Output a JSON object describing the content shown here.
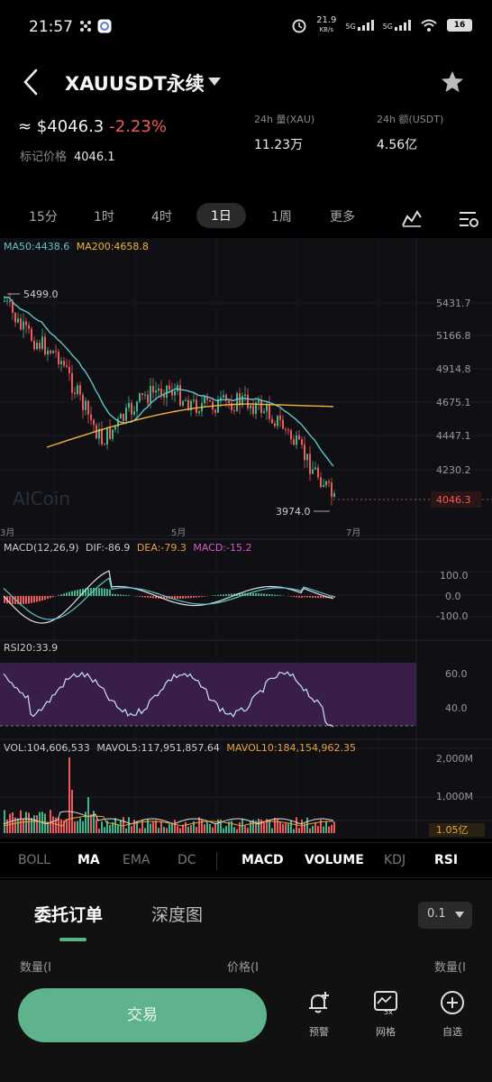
{
  "status_bar": {
    "time": "21:57",
    "speed": "21.9",
    "speed_unit": "KB/s",
    "net1": "5G",
    "net2": "5G",
    "battery": "16"
  },
  "header": {
    "title": "XAUUSDT永续"
  },
  "summary": {
    "price": "≈ $4046.3",
    "change_pct": "-2.23%",
    "mark_label": "标记价格",
    "mark_value": "4046.1",
    "vol_label": "24h 量(XAU)",
    "vol_value": "11.23万",
    "amount_label": "24h 额(USDT)",
    "amount_value": "4.56亿"
  },
  "timeframes": [
    "15分",
    "1时",
    "4时",
    "1日",
    "1周",
    "更多"
  ],
  "active_timeframe": "1日",
  "main_chart": {
    "ma_legend": [
      "MA50:4438.6",
      "MA200:4658.8"
    ],
    "y_ticks": [
      "5431.7",
      "5166.8",
      "4914.8",
      "4675.1",
      "4447.1",
      "4230.2"
    ],
    "current_price": "4046.3",
    "high_label": "5499.0",
    "low_label": "3974.0",
    "x_ticks": [
      "3月",
      "5月",
      "7月"
    ],
    "watermark": "AICoin"
  },
  "macd": {
    "legend_name": "MACD(12,26,9)",
    "dif": "DIF:-86.9",
    "dea": "DEA:-79.3",
    "macd": "MACD:-15.2",
    "y_ticks": [
      "100.0",
      "0.0",
      "-100.0"
    ]
  },
  "rsi": {
    "legend": "RSI20:33.9",
    "y_ticks": [
      "60.0",
      "40.0"
    ]
  },
  "volume": {
    "vol": "VOL:104,606,533",
    "mavol5": "MAVOL5:117,951,857.64",
    "mavol10": "MAVOL10:184,154,962.35",
    "y_ticks": [
      "2,000M",
      "1,000M",
      "1.05亿"
    ]
  },
  "indicator_tabs": [
    "BOLL",
    "MA",
    "EMA",
    "DC",
    "MACD",
    "VOLUME",
    "KDJ",
    "RSI"
  ],
  "indicator_active": [
    "MA",
    "MACD",
    "VOLUME",
    "RSI"
  ],
  "panel": {
    "tab_orders": "委托订单",
    "tab_depth": "深度图",
    "precision": "0.1",
    "col_qty_left": "数量(I",
    "col_price": "价格(I",
    "col_qty_right": "数量(I",
    "trade_button": "交易",
    "alert_label": "预警",
    "grid_label": "网格",
    "watchlist_label": "自选",
    "grid_badge": "5x"
  },
  "colors": {
    "up": "#3fb68b",
    "down": "#ef5a5a",
    "ma50": "#5fc6c9",
    "ma200": "#f0b43c",
    "macd_dea": "#e8a43c",
    "macd_label": "#d45ccf",
    "rsi_bg": "#3a1e4a",
    "accent": "#5fb38c"
  }
}
